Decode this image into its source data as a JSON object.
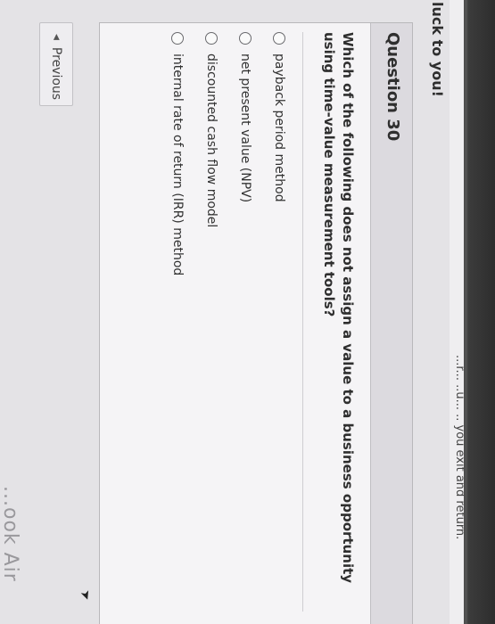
{
  "banner": {
    "text": "...r... ..u... .. you exit and return."
  },
  "greeting": "luck to you!",
  "question": {
    "number_label": "Question 30",
    "text": "Which of the following does not assign a value to a business opportunity using time-value measurement tools?",
    "choices": [
      {
        "label": "payback period method"
      },
      {
        "label": "net present value (NPV)"
      },
      {
        "label": "discounted cash flow model"
      },
      {
        "label": "internal rate of return (IRR) method"
      }
    ]
  },
  "navigation": {
    "previous_label": "Previous",
    "previous_icon": "triangle-left-icon"
  },
  "device": {
    "brand_partial": "...ook Air"
  }
}
